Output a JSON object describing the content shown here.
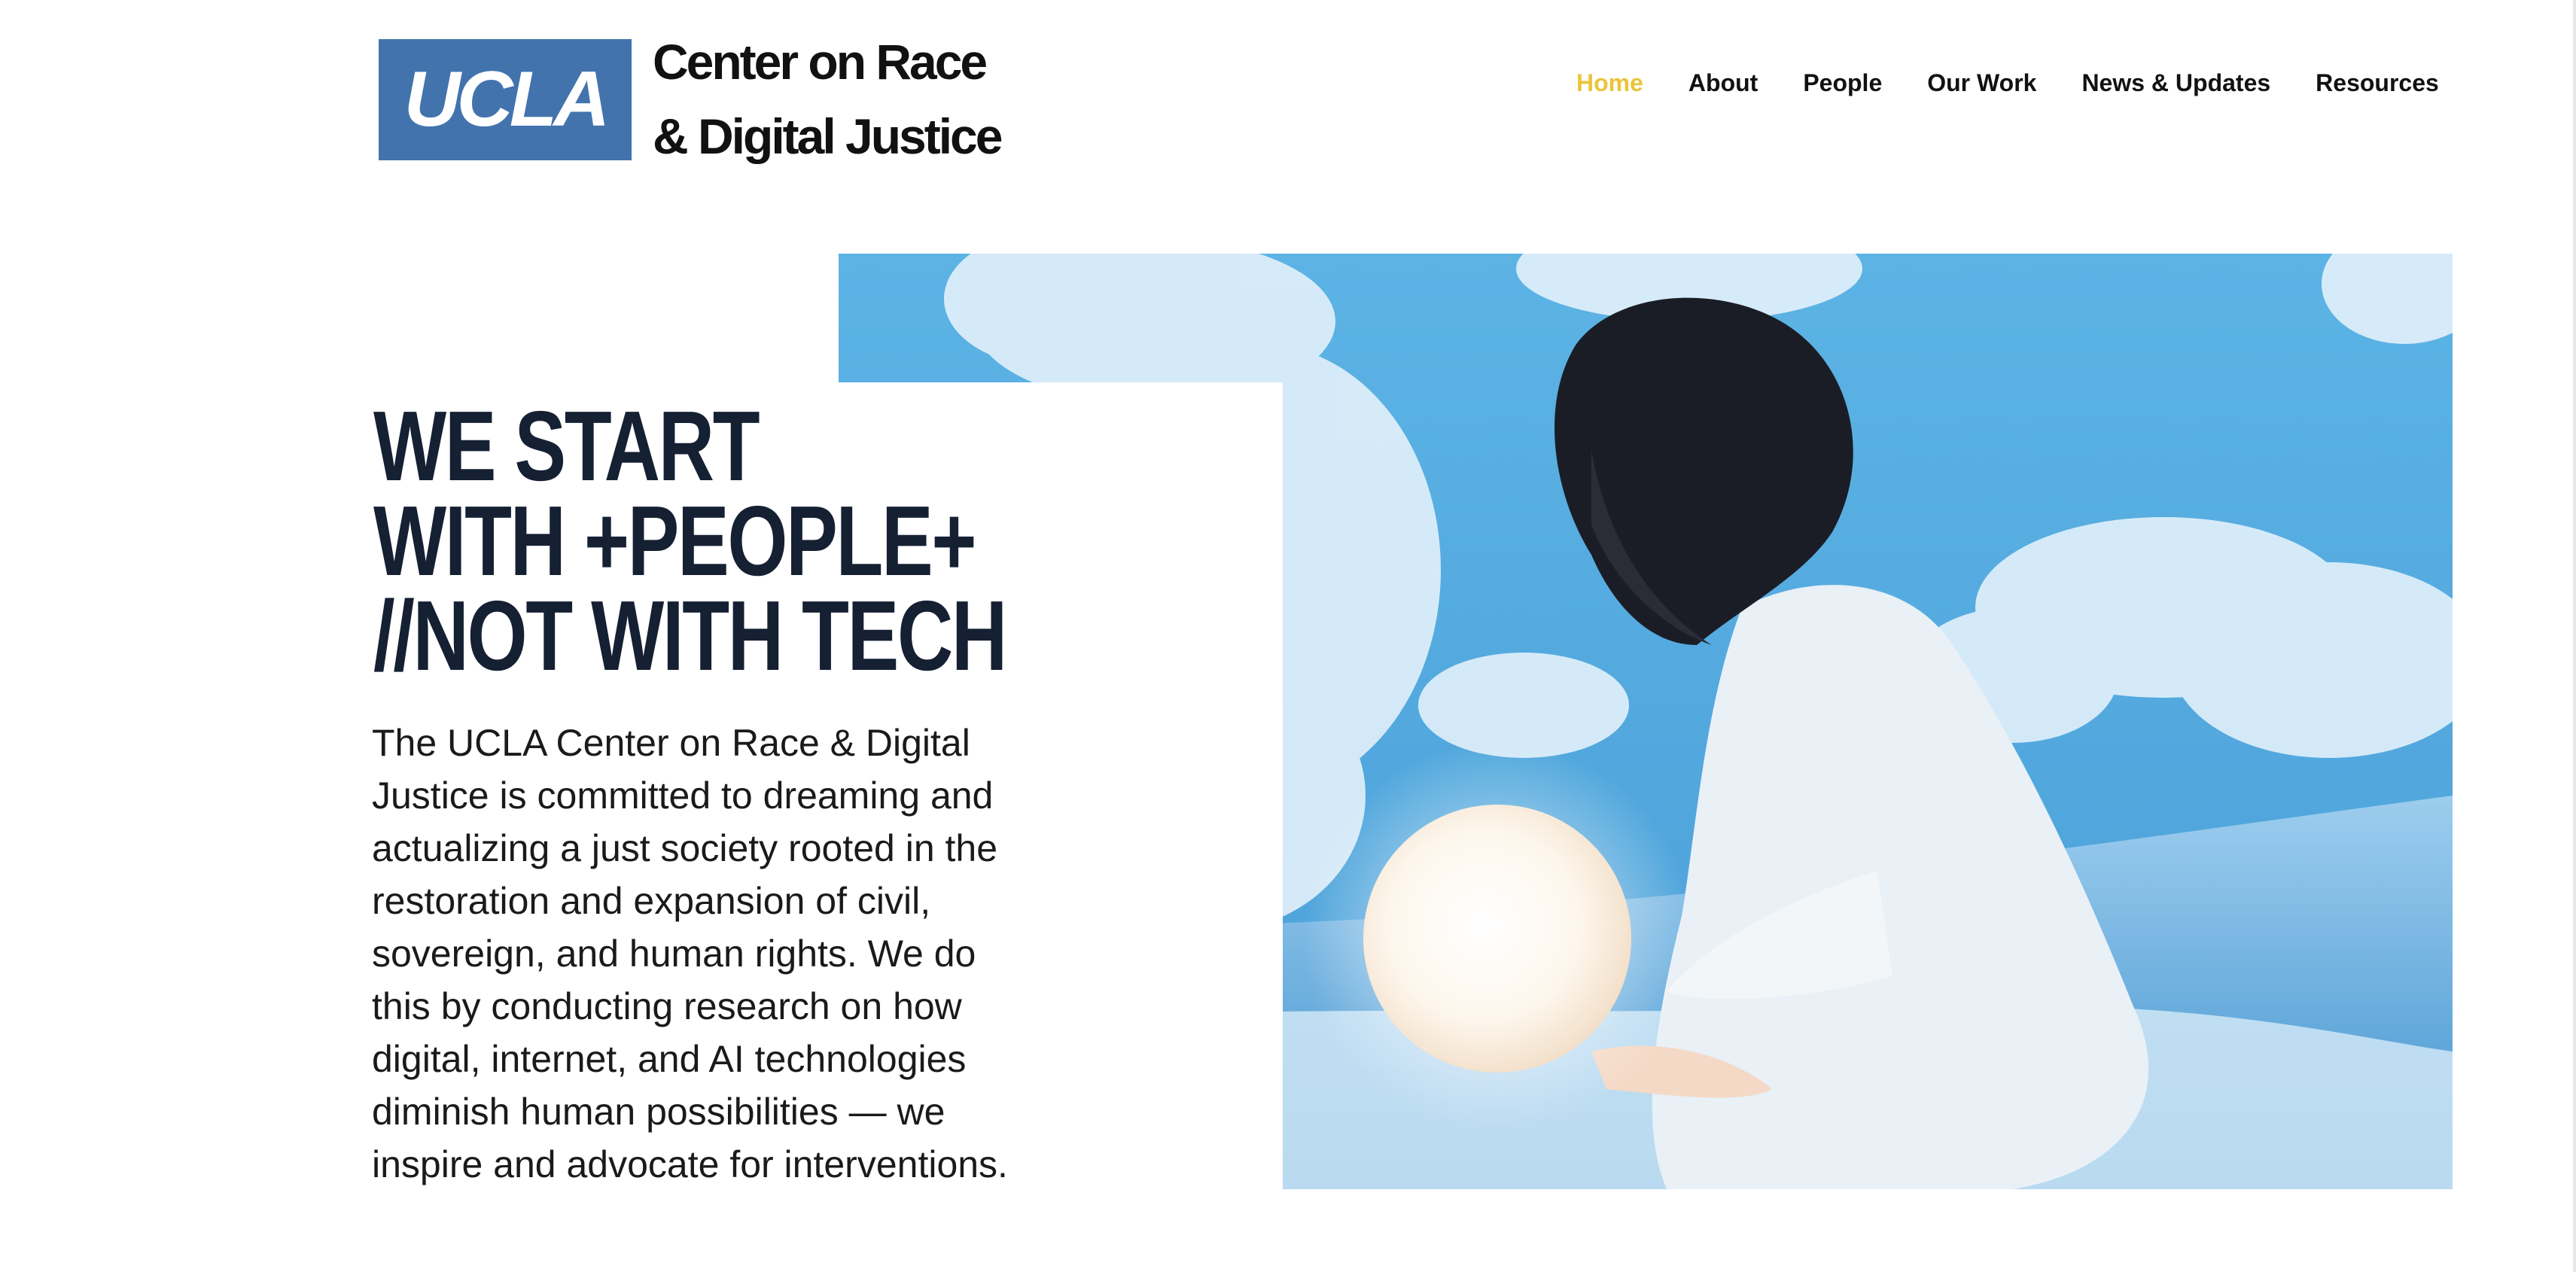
{
  "logo": {
    "badge_text": "UCLA",
    "line1": "Center on Race",
    "line2": "& Digital Justice"
  },
  "nav": {
    "items": [
      "Home",
      "About",
      "People",
      "Our Work",
      "News & Updates",
      "Resources"
    ],
    "active_color": "#eac43a"
  },
  "hero": {
    "headline_lines": [
      "WE START",
      "WITH +PEOPLE+",
      "//NOT WITH TECH"
    ],
    "description": "The UCLA Center on Race & Digital Justice is committed to dreaming and actualizing a just society rooted in the restoration and expansion of civil, sovereign, and human rights. We do this by conducting research on how digital, internet, and AI technologies diminish human possibilities — we inspire and advocate for interventions.",
    "image_subject": "person-holding-glowing-orb-in-clouds"
  },
  "colors": {
    "brand_blue": "#4273ad",
    "headline": "#152033",
    "sky": "#5aaee0"
  }
}
